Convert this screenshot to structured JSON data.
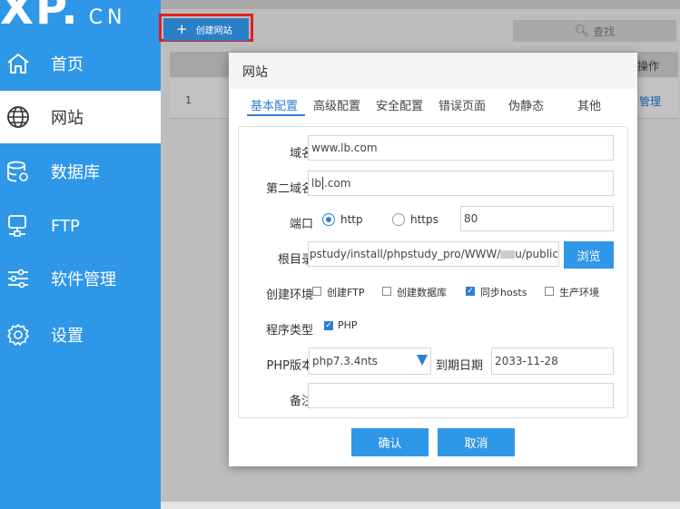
{
  "sidebar": {
    "logo_big": "XP.",
    "logo_small": "CN",
    "items": [
      {
        "label": "首页",
        "icon": "home-icon"
      },
      {
        "label": "网站",
        "icon": "globe-icon"
      },
      {
        "label": "数据库",
        "icon": "database-icon"
      },
      {
        "label": "FTP",
        "icon": "server-icon"
      },
      {
        "label": "软件管理",
        "icon": "sliders-icon"
      },
      {
        "label": "设置",
        "icon": "gear-icon"
      }
    ],
    "active_item": "网站",
    "accent_color": "#2f97e8"
  },
  "toolbar": {
    "create_label": "创建网站",
    "search_label": "查找"
  },
  "table": {
    "column_ops": "操作",
    "rows": [
      {
        "index": "1",
        "manage": "管理"
      }
    ]
  },
  "dialog": {
    "title": "网站",
    "tabs": [
      "基本配置",
      "高级配置",
      "安全配置",
      "错误页面",
      "伪静态",
      "其他"
    ],
    "active_tab": "基本配置",
    "labels": {
      "domain": "域名",
      "second_domain": "第二域名",
      "port": "端口",
      "root": "根目录",
      "env": "创建环境",
      "program_type": "程序类型",
      "php_version": "PHP版本",
      "expire": "到期日期",
      "note": "备注"
    },
    "domain_value": "www.lb.com",
    "second_domain_before_cursor": "lb",
    "second_domain_after_cursor": ".com",
    "protocol_options": [
      "http",
      "https"
    ],
    "protocol_selected": "http",
    "port_value": "80",
    "root_before_redacted": "pstudy/install/phpstudy_pro/WWW/",
    "root_after_redacted": "u/public",
    "browse_label": "浏览",
    "env_options": [
      {
        "label": "创建FTP",
        "checked": false
      },
      {
        "label": "创建数据库",
        "checked": false
      },
      {
        "label": "同步hosts",
        "checked": true
      },
      {
        "label": "生产环境",
        "checked": false
      }
    ],
    "program_option": {
      "label": "PHP",
      "checked": true
    },
    "php_version_value": "php7.3.4nts",
    "expire_value": "2033-11-28",
    "note_value": "",
    "confirm_label": "确认",
    "cancel_label": "取消"
  }
}
